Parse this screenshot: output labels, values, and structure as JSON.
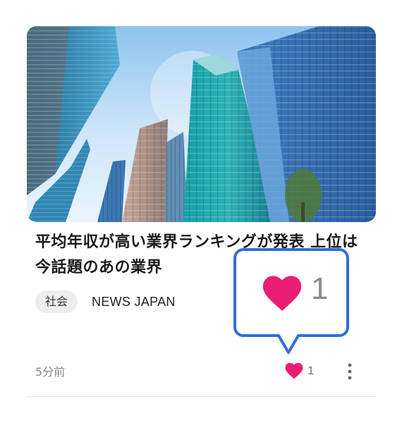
{
  "article": {
    "headline": "平均年収が高い業界ランキングが発表 上位は今話題のあの業界",
    "category": "社会",
    "source": "NEWS JAPAN",
    "time": "5分前",
    "like_count": "1"
  },
  "callout": {
    "like_count": "1"
  },
  "colors": {
    "heart": "#e91e73",
    "callout_border": "#2f6fd6",
    "chip_bg": "#eeeeee",
    "divider": "#e0e0e0"
  },
  "icons": {
    "like": "heart-icon",
    "more": "more-vertical-icon"
  }
}
